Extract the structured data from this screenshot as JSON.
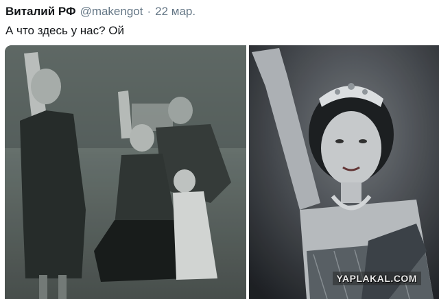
{
  "tweet": {
    "author": {
      "display_name": "Виталий РФ",
      "handle": "@makengot"
    },
    "separator": "·",
    "date": "22 мар.",
    "text": "А что здесь у нас? Ой",
    "media": {
      "watermark": "YAPLAKAL.COM"
    }
  },
  "colors": {
    "name": "#14171a",
    "secondary": "#657786",
    "background": "#ffffff"
  }
}
